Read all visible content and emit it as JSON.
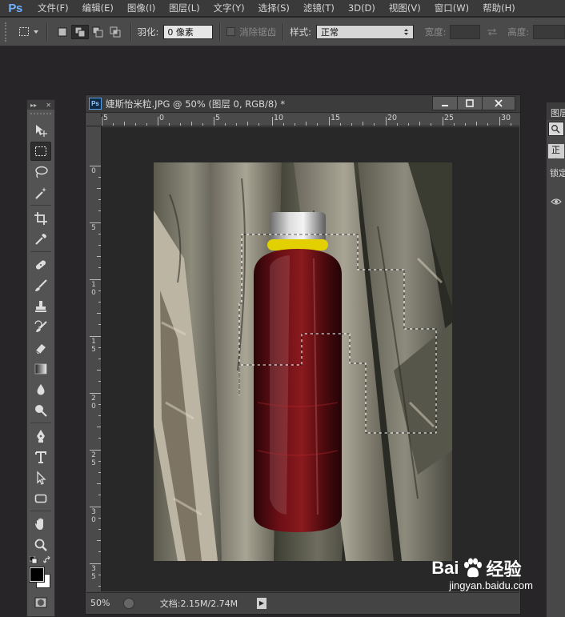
{
  "menubar": {
    "logo": "Ps",
    "items": [
      "文件(F)",
      "编辑(E)",
      "图像(I)",
      "图层(L)",
      "文字(Y)",
      "选择(S)",
      "滤镜(T)",
      "3D(D)",
      "视图(V)",
      "窗口(W)",
      "帮助(H)"
    ]
  },
  "options": {
    "feather_label": "羽化:",
    "feather_value": "0 像素",
    "antialias_label": "消除锯齿",
    "style_label": "样式:",
    "style_value": "正常",
    "width_label": "宽度:",
    "height_label": "高度:"
  },
  "document": {
    "title": "婕斯怡米粒.JPG @ 50% (图层 0, RGB/8) *",
    "badge": "Ps",
    "zoom": "50%",
    "doc_size": "文档:2.15M/2.74M",
    "ruler_h": [
      "5",
      "0",
      "5",
      "10",
      "15",
      "20",
      "25",
      "30"
    ],
    "ruler_v": [
      "0",
      "5",
      "10",
      "15",
      "20",
      "25",
      "30",
      "35"
    ]
  },
  "panel": {
    "title": "图层",
    "blend": "正常",
    "lock": "锁定"
  },
  "watermark": {
    "brand": "Bai",
    "brand_suffix": "经验",
    "url": "jingyan.baidu.com"
  },
  "colors": {
    "menubar": "#3a3a3a",
    "optbar": "#4a4a4a",
    "workspace": "#272528",
    "selection": "#ffffff",
    "bottle_liquid": "#5a0d12",
    "bottle_band": "#e8d400"
  }
}
